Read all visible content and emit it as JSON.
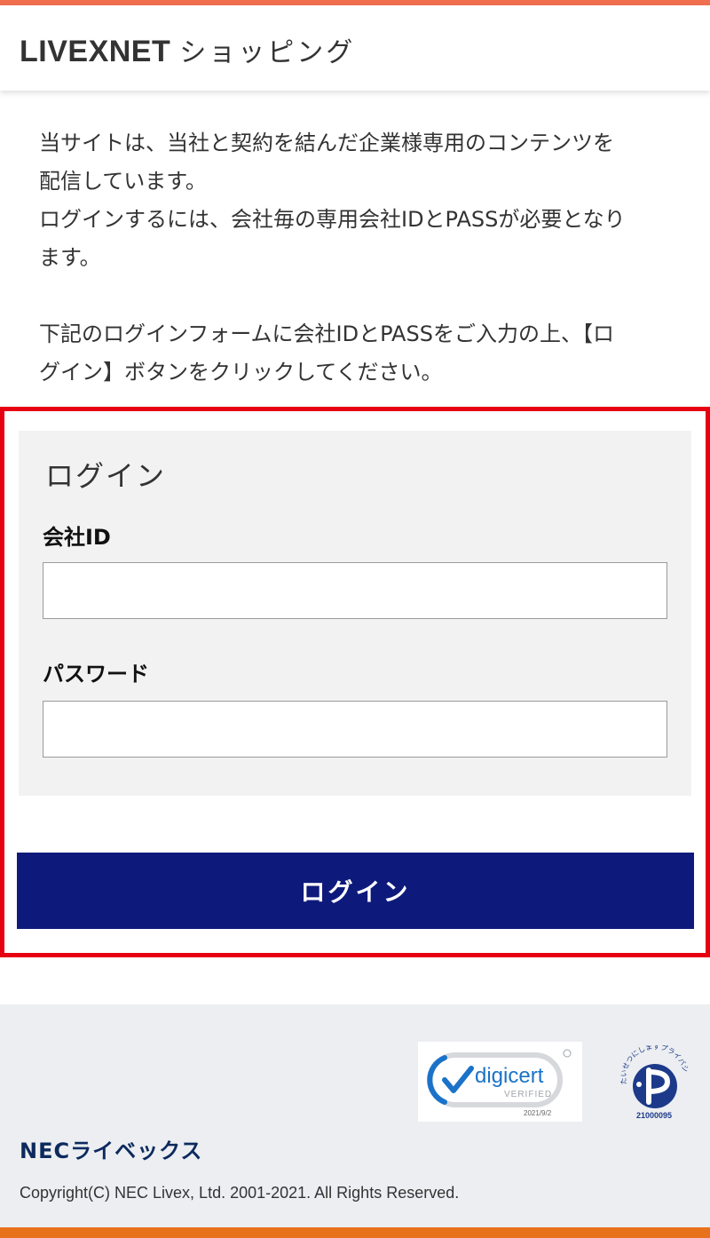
{
  "header": {
    "brand": "LIVEXNET",
    "subtitle": "ショッピング"
  },
  "intro": {
    "lines": [
      "当サイトは、当社と契約を結んだ企業様専用のコンテンツを",
      "配信しています。",
      "ログインするには、会社毎の専用会社IDとPASSが必要となり",
      "ます。",
      "",
      "下記のログインフォームに会社IDとPASSをご入力の上、【ロ",
      "グイン】ボタンをクリックしてください。"
    ]
  },
  "login": {
    "heading": "ログイン",
    "company_id_label": "会社ID",
    "company_id_value": "",
    "password_label": "パスワード",
    "password_value": "",
    "button_label": "ログイン"
  },
  "badges": {
    "digicert_name": "digicert",
    "digicert_status": "VERIFIED",
    "digicert_date": "2021/9/2",
    "privacy_mark_text": "たいせつにしますプライバシー",
    "privacy_mark_number": "21000095"
  },
  "footer": {
    "company": "NECライベックス",
    "copyright": "Copyright(C) NEC Livex, Ltd. 2001-2021. All Rights Reserved."
  },
  "colors": {
    "top_accent": "#ef6f4f",
    "bottom_accent": "#e8721c",
    "login_button": "#0d1a7b",
    "highlight_frame": "#e60012",
    "company_name": "#0d2a5e"
  }
}
